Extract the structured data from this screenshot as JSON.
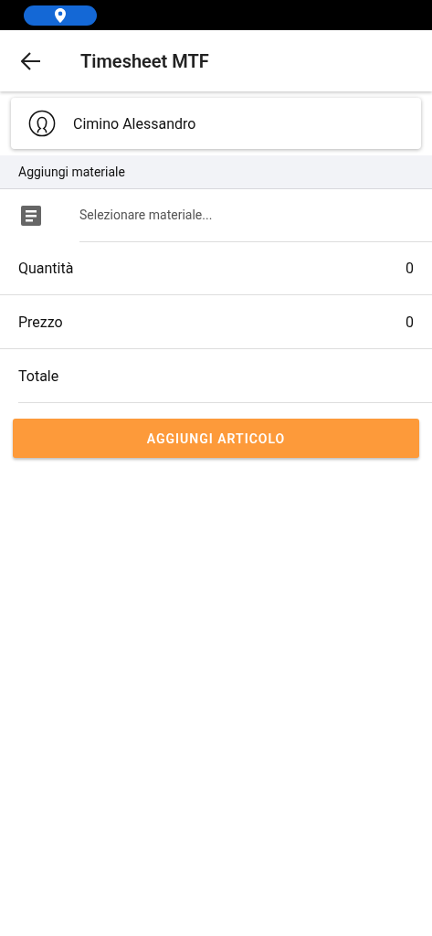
{
  "app_bar": {
    "title": "Timesheet MTF"
  },
  "user_card": {
    "name": "Cimino Alessandro"
  },
  "section": {
    "title": "Aggiungi materiale"
  },
  "material_field": {
    "placeholder": "Selezionare materiale..."
  },
  "fields": [
    {
      "label": "Quantità",
      "value": "0"
    },
    {
      "label": "Prezzo",
      "value": "0"
    },
    {
      "label": "Totale"
    }
  ],
  "button": {
    "label": "AGGIUNGI ARTICOLO"
  }
}
